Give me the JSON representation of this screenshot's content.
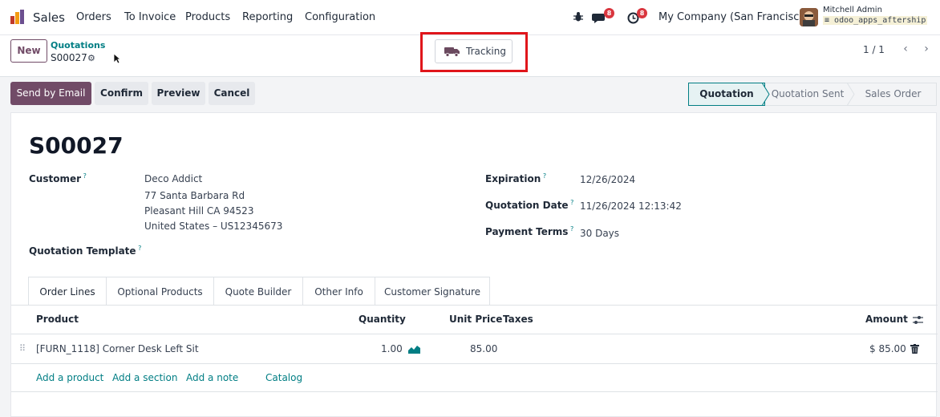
{
  "navbar": {
    "app_name": "Sales",
    "menu": [
      "Orders",
      "To Invoice",
      "Products",
      "Reporting",
      "Configuration"
    ],
    "messages_badge": "8",
    "activities_badge": "8",
    "company": "My Company (San Francisco)",
    "user_name": "Mitchell Admin",
    "database": "odoo_apps_aftership"
  },
  "control": {
    "new_label": "New",
    "breadcrumb_parent": "Quotations",
    "breadcrumb_current": "S00027",
    "tracking_label": "Tracking",
    "pager": "1 / 1"
  },
  "actions": {
    "send_email": "Send by Email",
    "confirm": "Confirm",
    "preview": "Preview",
    "cancel": "Cancel"
  },
  "status": [
    "Quotation",
    "Quotation Sent",
    "Sales Order"
  ],
  "form": {
    "name": "S00027",
    "customer_label": "Customer",
    "customer_lines": [
      "Deco Addict",
      "77 Santa Barbara Rd",
      "Pleasant Hill CA 94523",
      "United States – US12345673"
    ],
    "template_label": "Quotation Template",
    "expiration_label": "Expiration",
    "expiration_value": "12/26/2024",
    "quotation_date_label": "Quotation Date",
    "quotation_date_value": "11/26/2024 12:13:42",
    "payment_terms_label": "Payment Terms",
    "payment_terms_value": "30 Days"
  },
  "tabs": [
    "Order Lines",
    "Optional Products",
    "Quote Builder",
    "Other Info",
    "Customer Signature"
  ],
  "table": {
    "headers": {
      "product": "Product",
      "quantity": "Quantity",
      "unit_price": "Unit Price",
      "taxes": "Taxes",
      "amount": "Amount"
    },
    "rows": [
      {
        "product": "[FURN_1118] Corner Desk Left Sit",
        "quantity": "1.00",
        "unit_price": "85.00",
        "taxes": "",
        "amount": "$ 85.00"
      }
    ],
    "add_product": "Add a product",
    "add_section": "Add a section",
    "add_note": "Add a note",
    "catalog": "Catalog"
  },
  "colors": {
    "brand": "#714b67",
    "teal": "#017e84",
    "highlight": "#e0161b",
    "badge": "#d9363e"
  },
  "icons": [
    "odoo-logo-icon",
    "bug-icon",
    "chat-icon",
    "clock-icon",
    "gear-icon",
    "truck-icon",
    "chevron-left-icon",
    "chevron-right-icon",
    "drag-handle-icon",
    "forecast-chart-icon",
    "trash-icon",
    "column-settings-icon"
  ]
}
